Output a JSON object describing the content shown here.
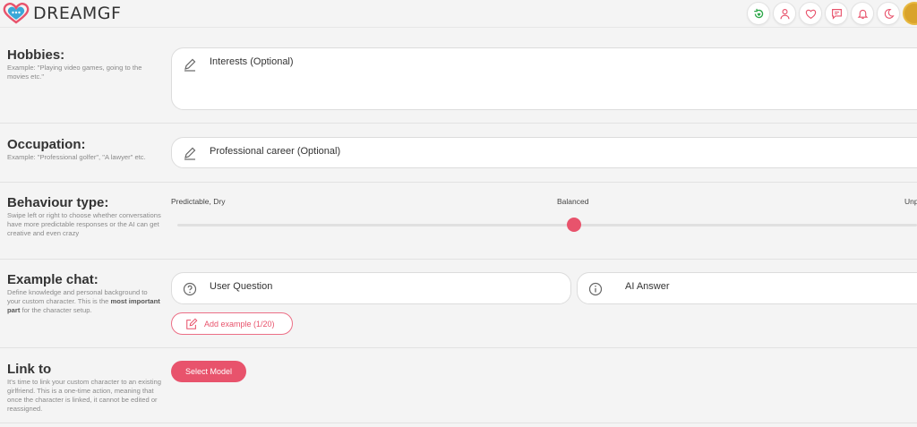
{
  "brand": {
    "name": "DREAMGF",
    "accent": "#e8536c"
  },
  "header_icons": [
    "refresh-heart-icon",
    "user-icon",
    "heart-icon",
    "chat-icon",
    "bell-icon",
    "moon-icon",
    "avatar"
  ],
  "hobbies": {
    "title": "Hobbies:",
    "description": "Example: \"Playing video games, going to the movies etc.\"",
    "placeholder": "Interests (Optional)"
  },
  "occupation": {
    "title": "Occupation:",
    "description": "Example: \"Professional golfer\", \"A lawyer\" etc.",
    "placeholder": "Professional career (Optional)"
  },
  "behaviour": {
    "title": "Behaviour type:",
    "description": "Swipe left or right to choose whether conversations have more predictable responses or the AI can get creative and even crazy",
    "left_label": "Predictable, Dry",
    "middle_label": "Balanced",
    "right_label": "Unp",
    "value": 0.5
  },
  "example_chat": {
    "title": "Example chat:",
    "description_before": "Define knowledge and personal background to your custom character. This is the ",
    "description_bold": "most important part",
    "description_after": " for the character setup.",
    "user_placeholder": "User Question",
    "ai_placeholder": "AI Answer",
    "add_label": "Add example (1/20)"
  },
  "link_to": {
    "title": "Link to",
    "description": "It's time to link your custom character to an existing girlfriend. This is a one-time action, meaning that once the character is linked, it cannot be edited or reassigned.",
    "button_label": "Select Model"
  }
}
